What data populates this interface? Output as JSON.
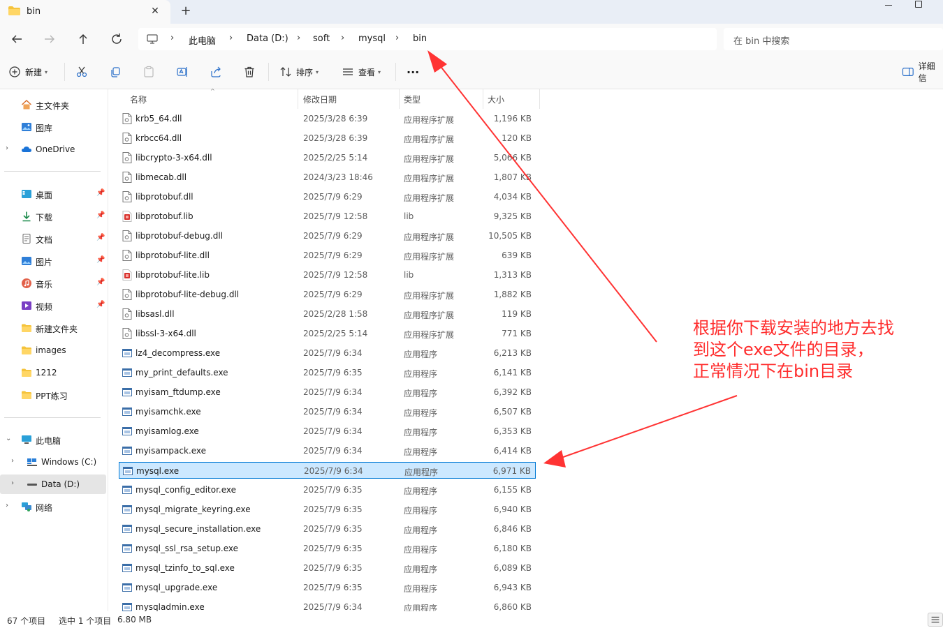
{
  "tab": {
    "title": "bin",
    "close": "✕",
    "add": "+"
  },
  "breadcrumbs": [
    "此电脑",
    "Data (D:)",
    "soft",
    "mysql",
    "bin"
  ],
  "breadcrumb_sep": "›",
  "search": {
    "placeholder": "在 bin 中搜索"
  },
  "toolbar": {
    "new_label": "新建",
    "sort_label": "排序",
    "view_label": "查看",
    "more_label": "···",
    "details_label": "详细信"
  },
  "sidebar": {
    "quick": [
      {
        "label": "主文件夹",
        "icon": "home-icon"
      },
      {
        "label": "图库",
        "icon": "gallery-icon"
      },
      {
        "label": "OneDrive",
        "icon": "cloud-icon"
      }
    ],
    "pinned": [
      {
        "label": "桌面",
        "icon": "desktop-icon",
        "pinned": true
      },
      {
        "label": "下载",
        "icon": "download-icon",
        "pinned": true
      },
      {
        "label": "文档",
        "icon": "document-icon",
        "pinned": true
      },
      {
        "label": "图片",
        "icon": "picture-icon",
        "pinned": true
      },
      {
        "label": "音乐",
        "icon": "music-icon",
        "pinned": true
      },
      {
        "label": "视频",
        "icon": "video-icon",
        "pinned": true
      },
      {
        "label": "新建文件夹",
        "icon": "folder-icon",
        "pinned": false
      },
      {
        "label": "images",
        "icon": "folder-icon",
        "pinned": false
      },
      {
        "label": "1212",
        "icon": "folder-icon",
        "pinned": false
      },
      {
        "label": "PPT练习",
        "icon": "folder-icon",
        "pinned": false
      }
    ],
    "tree": [
      {
        "label": "此电脑",
        "icon": "pc-icon"
      },
      {
        "label": "Windows (C:)",
        "icon": "windows-drive-icon"
      },
      {
        "label": "Data (D:)",
        "icon": "drive-icon",
        "selected": true
      },
      {
        "label": "网络",
        "icon": "network-icon"
      }
    ],
    "pin_glyph": "📌"
  },
  "columns": {
    "name": "名称",
    "date": "修改日期",
    "type": "类型",
    "size": "大小"
  },
  "files": [
    {
      "name": "krb5_64.dll",
      "date": "2025/3/28 6:39",
      "type": "应用程序扩展",
      "size": "1,196 KB",
      "kind": "dll"
    },
    {
      "name": "krbcc64.dll",
      "date": "2025/3/28 6:39",
      "type": "应用程序扩展",
      "size": "120 KB",
      "kind": "dll"
    },
    {
      "name": "libcrypto-3-x64.dll",
      "date": "2025/2/25 5:14",
      "type": "应用程序扩展",
      "size": "5,066 KB",
      "kind": "dll"
    },
    {
      "name": "libmecab.dll",
      "date": "2024/3/23 18:46",
      "type": "应用程序扩展",
      "size": "1,807 KB",
      "kind": "dll"
    },
    {
      "name": "libprotobuf.dll",
      "date": "2025/7/9 6:29",
      "type": "应用程序扩展",
      "size": "4,034 KB",
      "kind": "dll"
    },
    {
      "name": "libprotobuf.lib",
      "date": "2025/7/9 12:58",
      "type": "lib",
      "size": "9,325 KB",
      "kind": "lib"
    },
    {
      "name": "libprotobuf-debug.dll",
      "date": "2025/7/9 6:29",
      "type": "应用程序扩展",
      "size": "10,505 KB",
      "kind": "dll"
    },
    {
      "name": "libprotobuf-lite.dll",
      "date": "2025/7/9 6:29",
      "type": "应用程序扩展",
      "size": "639 KB",
      "kind": "dll"
    },
    {
      "name": "libprotobuf-lite.lib",
      "date": "2025/7/9 12:58",
      "type": "lib",
      "size": "1,313 KB",
      "kind": "lib"
    },
    {
      "name": "libprotobuf-lite-debug.dll",
      "date": "2025/7/9 6:29",
      "type": "应用程序扩展",
      "size": "1,882 KB",
      "kind": "dll"
    },
    {
      "name": "libsasl.dll",
      "date": "2025/2/28 1:58",
      "type": "应用程序扩展",
      "size": "119 KB",
      "kind": "dll"
    },
    {
      "name": "libssl-3-x64.dll",
      "date": "2025/2/25 5:14",
      "type": "应用程序扩展",
      "size": "771 KB",
      "kind": "dll"
    },
    {
      "name": "lz4_decompress.exe",
      "date": "2025/7/9 6:34",
      "type": "应用程序",
      "size": "6,213 KB",
      "kind": "exe"
    },
    {
      "name": "my_print_defaults.exe",
      "date": "2025/7/9 6:35",
      "type": "应用程序",
      "size": "6,141 KB",
      "kind": "exe"
    },
    {
      "name": "myisam_ftdump.exe",
      "date": "2025/7/9 6:34",
      "type": "应用程序",
      "size": "6,392 KB",
      "kind": "exe"
    },
    {
      "name": "myisamchk.exe",
      "date": "2025/7/9 6:34",
      "type": "应用程序",
      "size": "6,507 KB",
      "kind": "exe"
    },
    {
      "name": "myisamlog.exe",
      "date": "2025/7/9 6:34",
      "type": "应用程序",
      "size": "6,353 KB",
      "kind": "exe"
    },
    {
      "name": "myisampack.exe",
      "date": "2025/7/9 6:34",
      "type": "应用程序",
      "size": "6,414 KB",
      "kind": "exe"
    },
    {
      "name": "mysql.exe",
      "date": "2025/7/9 6:34",
      "type": "应用程序",
      "size": "6,971 KB",
      "kind": "exe",
      "selected": true
    },
    {
      "name": "mysql_config_editor.exe",
      "date": "2025/7/9 6:35",
      "type": "应用程序",
      "size": "6,155 KB",
      "kind": "exe"
    },
    {
      "name": "mysql_migrate_keyring.exe",
      "date": "2025/7/9 6:35",
      "type": "应用程序",
      "size": "6,940 KB",
      "kind": "exe"
    },
    {
      "name": "mysql_secure_installation.exe",
      "date": "2025/7/9 6:35",
      "type": "应用程序",
      "size": "6,846 KB",
      "kind": "exe"
    },
    {
      "name": "mysql_ssl_rsa_setup.exe",
      "date": "2025/7/9 6:35",
      "type": "应用程序",
      "size": "6,180 KB",
      "kind": "exe"
    },
    {
      "name": "mysql_tzinfo_to_sql.exe",
      "date": "2025/7/9 6:35",
      "type": "应用程序",
      "size": "6,089 KB",
      "kind": "exe"
    },
    {
      "name": "mysql_upgrade.exe",
      "date": "2025/7/9 6:35",
      "type": "应用程序",
      "size": "6,943 KB",
      "kind": "exe"
    },
    {
      "name": "mysqladmin.exe",
      "date": "2025/7/9 6:34",
      "type": "应用程序",
      "size": "6,860 KB",
      "kind": "exe"
    }
  ],
  "status": {
    "count": "67 个项目",
    "selection": "选中 1 个项目",
    "size": "6.80 MB"
  },
  "annotation": {
    "text": "根据你下载安装的地方去找\n到这个exe文件的目录，\n正常情况下在bin目录",
    "color": "#ff2d2d"
  },
  "colors": {
    "accent": "#0078d4",
    "selection_bg": "#cce8ff",
    "annotation": "#ff2d2d"
  }
}
